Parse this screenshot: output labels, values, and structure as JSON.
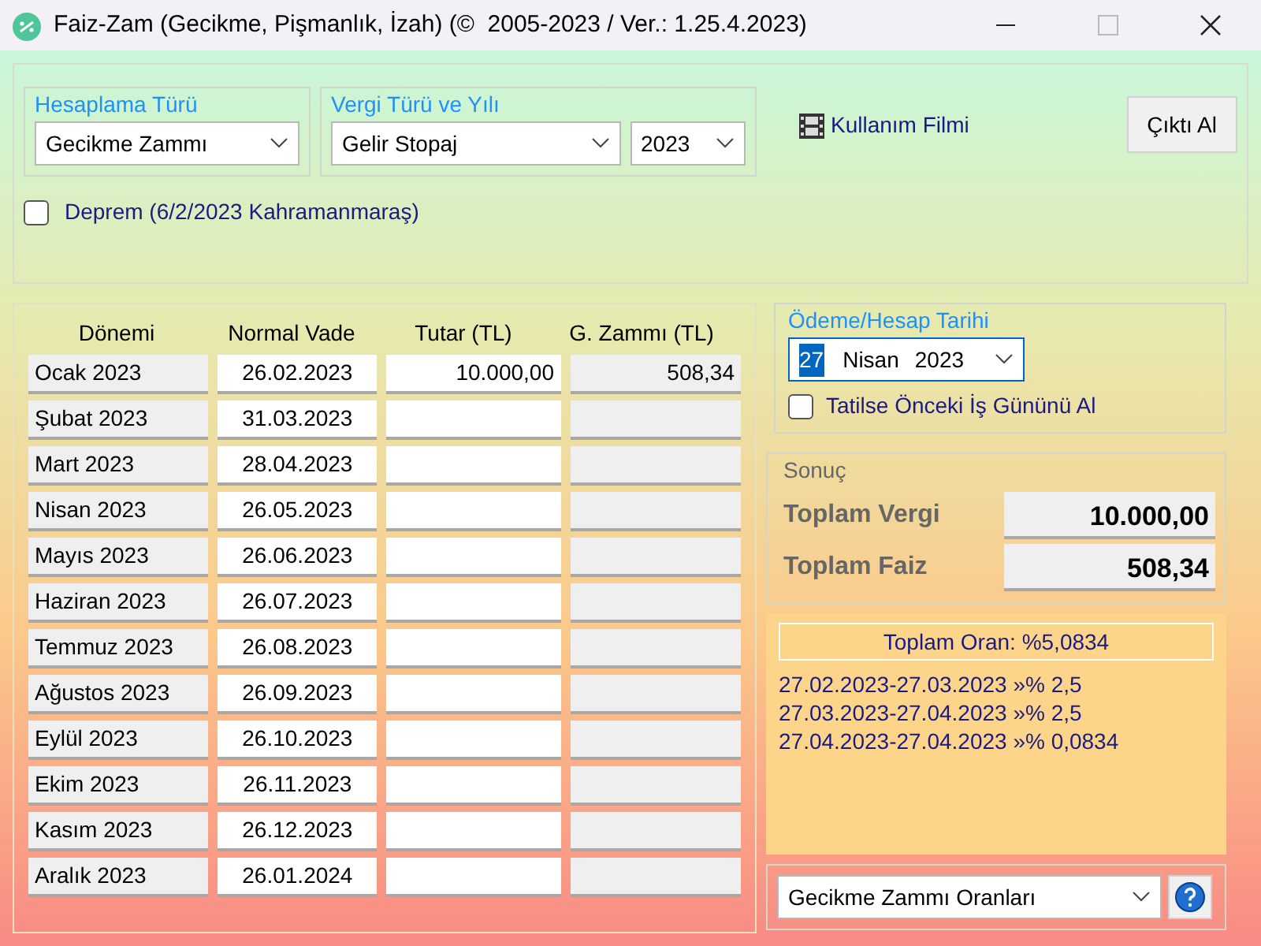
{
  "window": {
    "title": "Faiz-Zam (Gecikme, Pişmanlık, İzah) (©  2005-2023 / Ver.: 1.25.4.2023)"
  },
  "calc_type": {
    "legend": "Hesaplama Türü",
    "value": "Gecikme Zammı"
  },
  "tax_type": {
    "legend": "Vergi Türü ve Yılı",
    "value": "Gelir Stopaj",
    "year": "2023"
  },
  "film_link": "Kullanım Filmi",
  "print_button": "Çıktı Al",
  "earthquake": {
    "label": "Deprem (6/2/2023 Kahramanmaraş)",
    "checked": false
  },
  "table": {
    "columns": [
      "Dönemi",
      "Normal Vade",
      "Tutar (TL)",
      "G. Zammı (TL)"
    ],
    "rows": [
      {
        "period": "Ocak 2023",
        "due": "26.02.2023",
        "amount": "10.000,00",
        "interest": "508,34"
      },
      {
        "period": "Şubat 2023",
        "due": "31.03.2023"
      },
      {
        "period": "Mart 2023",
        "due": "28.04.2023"
      },
      {
        "period": "Nisan 2023",
        "due": "26.05.2023"
      },
      {
        "period": "Mayıs 2023",
        "due": "26.06.2023"
      },
      {
        "period": "Haziran 2023",
        "due": "26.07.2023"
      },
      {
        "period": "Temmuz 2023",
        "due": "26.08.2023"
      },
      {
        "period": "Ağustos 2023",
        "due": "26.09.2023"
      },
      {
        "period": "Eylül 2023",
        "due": "26.10.2023"
      },
      {
        "period": "Ekim 2023",
        "due": "26.11.2023"
      },
      {
        "period": "Kasım 2023",
        "due": "26.12.2023"
      },
      {
        "period": "Aralık 2023",
        "due": "26.01.2024"
      }
    ]
  },
  "payment_date": {
    "legend": "Ödeme/Hesap Tarihi",
    "day": "27",
    "day_selected": true,
    "month": "Nisan",
    "year": "2023",
    "holiday": {
      "label": "Tatilse Önceki İş Gününü Al",
      "checked": false
    }
  },
  "result": {
    "legend": "Sonuç",
    "rows": [
      {
        "label": "Toplam Vergi",
        "value": "10.000,00"
      },
      {
        "label": "Toplam Faiz",
        "value": "508,34"
      }
    ]
  },
  "rates": {
    "total": "Toplam Oran: %5,0834",
    "lines": [
      "27.02.2023-27.03.2023 »% 2,5",
      "27.03.2023-27.04.2023 »% 2,5",
      "27.04.2023-27.04.2023 »% 0,0834"
    ]
  },
  "rate_list": {
    "value": "Gecikme Zammı Oranları"
  }
}
